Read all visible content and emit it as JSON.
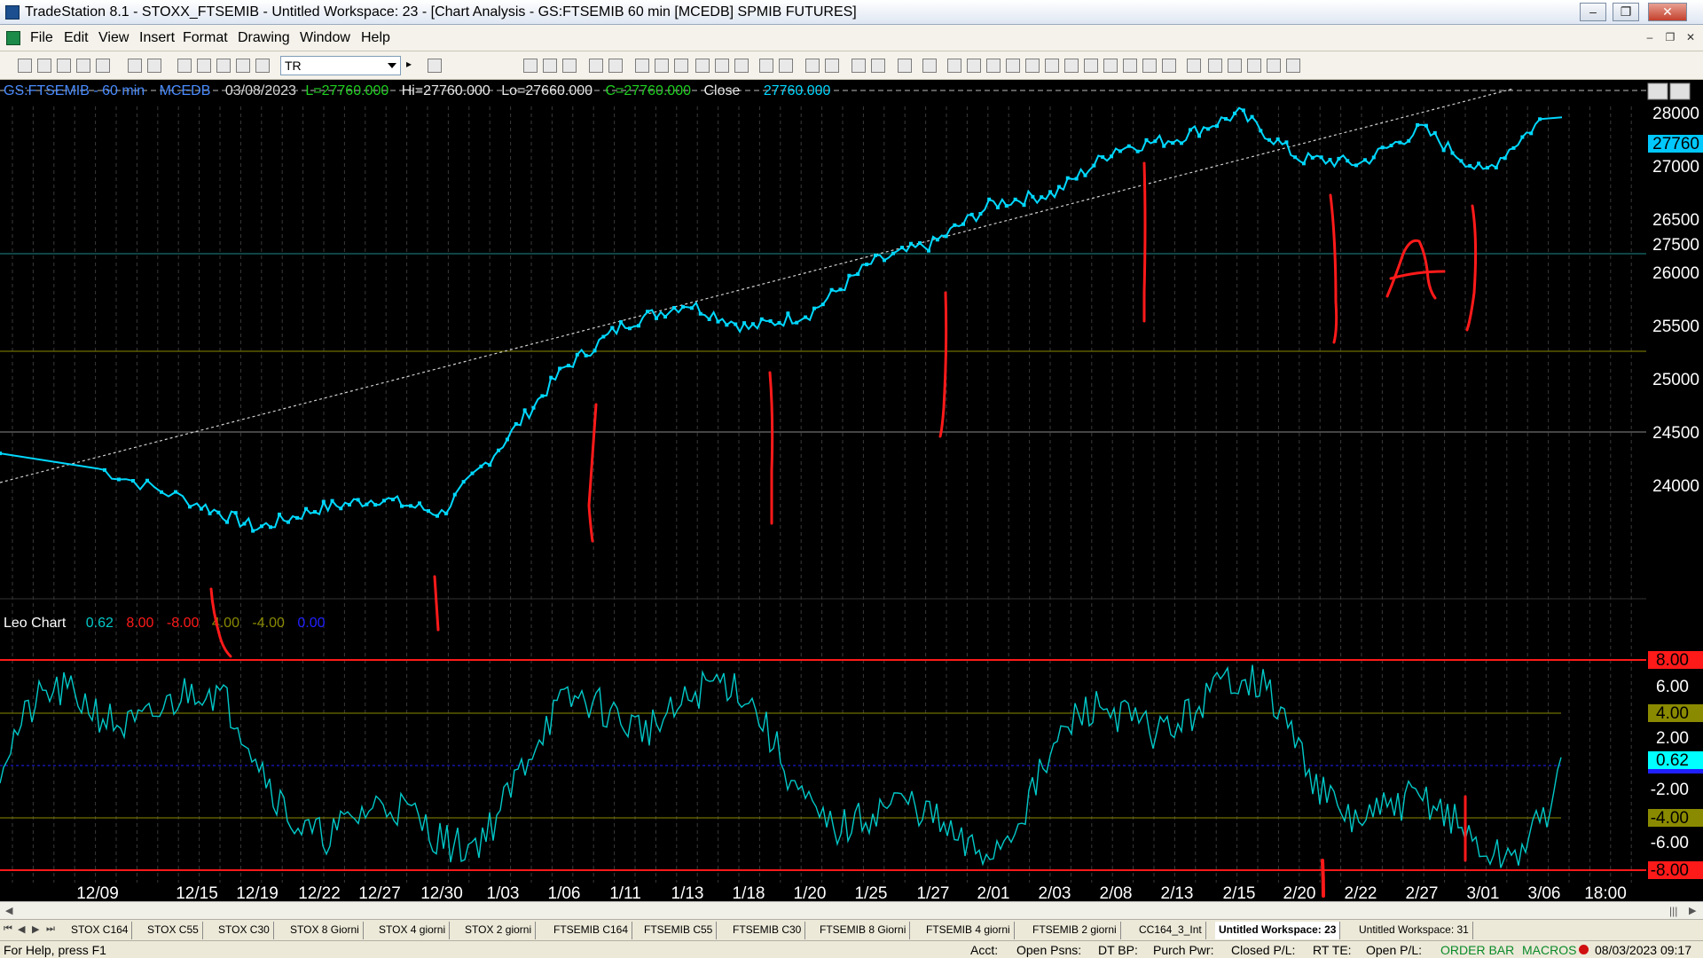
{
  "window": {
    "title": "TradeStation 8.1 - STOXX_FTSEMIB - Untitled Workspace:  23 - [Chart Analysis - GS:FTSEMIB  60 min  [MCEDB] SPMIB FUTURES]",
    "minimize": "‒",
    "maximize": "❐",
    "close": "✕"
  },
  "menu": {
    "items": [
      "File",
      "Edit",
      "View",
      "Insert",
      "Format",
      "Drawing",
      "Window",
      "Help"
    ]
  },
  "toolbar": {
    "symbol_value": "TR"
  },
  "chart": {
    "header": {
      "symbol_interval": "GS:FTSEMIB - 60 min",
      "exchange": "MCEDB",
      "date": "03/08/2023",
      "last": "L=27760.000",
      "high": "Hi=27760.000",
      "low": "Lo=27660.000",
      "close_eq": "C=27760.000",
      "close_label": "Close",
      "close_value": "27760.000"
    },
    "colors": {
      "price": "#00d8ff",
      "indicator": "#00c8c8",
      "red": "#ff1a1a",
      "olive": "#8a8a00",
      "blue": "#2020ff",
      "text_green": "#20d020",
      "header_blue": "#4a8cff"
    },
    "price_axis": {
      "ticks": [
        "28000",
        "27500",
        "27000",
        "26500",
        "26000",
        "25500",
        "25000",
        "24500",
        "24000"
      ],
      "last_price_label": "27760"
    },
    "indicator": {
      "name": "Leo Chart",
      "values": [
        "0.62",
        "8.00",
        "-8.00",
        "4.00",
        "-4.00",
        "0.00"
      ],
      "axis_ticks": [
        "6.00",
        "2.00",
        "-2.00",
        "-6.00"
      ],
      "tag_8": "8.00",
      "tag_4": "4.00",
      "tag_0": "0.62",
      "tag_m4": "-4.00",
      "tag_m8": "-8.00"
    },
    "time_axis": [
      "12/09",
      "12/15",
      "12/19",
      "12/22",
      "12/27",
      "12/30",
      "1/03",
      "1/06",
      "1/11",
      "1/13",
      "1/18",
      "1/20",
      "1/25",
      "1/27",
      "2/01",
      "2/03",
      "2/08",
      "2/13",
      "2/15",
      "2/20",
      "2/22",
      "2/27",
      "3/01",
      "3/06",
      "18:00"
    ]
  },
  "chart_data": {
    "type": "line",
    "title": "GS:FTSEMIB - 60 min",
    "x": [
      "12/09",
      "12/15",
      "12/19",
      "12/22",
      "12/27",
      "12/30",
      "1/03",
      "1/06",
      "1/11",
      "1/13",
      "1/18",
      "1/20",
      "1/25",
      "1/27",
      "2/01",
      "2/03",
      "2/08",
      "2/13",
      "2/15",
      "2/20",
      "2/22",
      "2/27",
      "3/01",
      "3/06"
    ],
    "series": [
      {
        "values": [
          24250,
          23900,
          23650,
          23850,
          23950,
          23800,
          24500,
          25250,
          25700,
          25900,
          25650,
          25800,
          26300,
          26500,
          26900,
          27000,
          27450,
          27550,
          27800,
          27350,
          27300,
          27650,
          27200,
          27760
        ]
      }
    ],
    "ylim": [
      23700,
      28100
    ],
    "indicator": {
      "name": "Leo Chart",
      "last": 0.62,
      "levels": [
        8,
        4,
        0,
        -4,
        -8
      ]
    }
  },
  "bottom": {
    "tabs": [
      "STOX C164",
      "STOX C55",
      "STOX  C30",
      "STOX  8 Giorni",
      "STOX 4 giorni",
      "STOX  2 giorni",
      "FTSEMIB C164",
      "FTSEMIB C55",
      "FTSEMIB C30",
      "FTSEMIB  8 Giorni",
      "FTSEMIB  4 giorni",
      "FTSEMIB  2 giorni",
      "CC164_3_Int",
      "Untitled Workspace:  23",
      "Untitled Workspace:  31"
    ]
  },
  "status": {
    "help": "For Help, press F1",
    "acct": "Acct:",
    "open_psns": "Open Psns:",
    "dt_bp": "DT BP:",
    "purch_pwr": "Purch Pwr:",
    "closed_pl": "Closed P/L:",
    "rt_te": "RT TE:",
    "open_pl": "Open P/L:",
    "order_bar": "ORDER BAR",
    "macros": "MACROS",
    "datetime": "08/03/2023 09:17"
  }
}
